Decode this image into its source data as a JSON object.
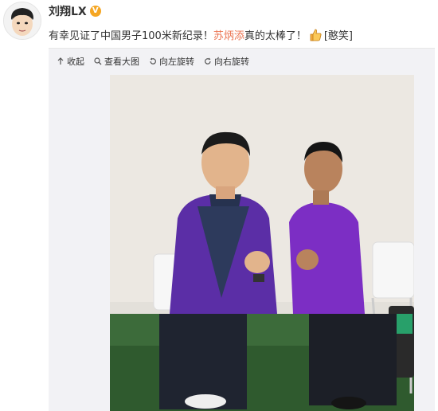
{
  "post": {
    "username": "刘翔LX",
    "verified_badge": "V",
    "text_before": "有幸见证了中国男子100米新纪录！",
    "mention": "苏炳添",
    "text_after": "真的太棒了！",
    "emoticon_label": "[憨笑]"
  },
  "toolbar": {
    "collapse": "收起",
    "view_large": "查看大图",
    "rotate_left": "向左旋转",
    "rotate_right": "向右旋转"
  },
  "colors": {
    "mention": "#eb7350",
    "badge": "#f5a623",
    "panel_bg": "#f2f2f5"
  },
  "icons": [
    "avatar-cartoon",
    "verified-badge-icon",
    "thumbs-up-icon",
    "collapse-arrow-icon",
    "magnifier-icon",
    "rotate-left-icon",
    "rotate-right-icon"
  ]
}
